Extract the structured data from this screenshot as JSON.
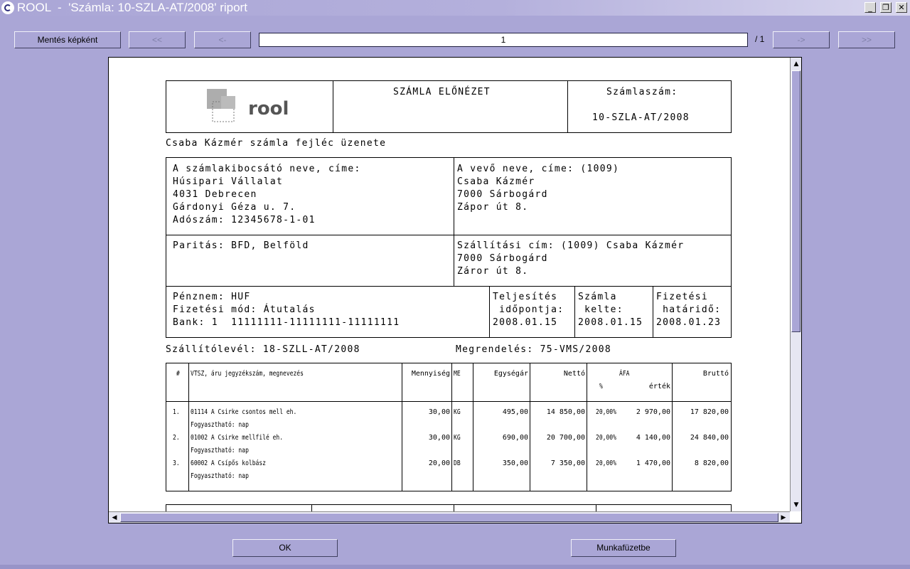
{
  "window": {
    "title": "ROOL  -  'Számla: 10-SZLA-AT/2008' riport",
    "minimize": "_",
    "restore": "❐",
    "close": "✕"
  },
  "toolbar": {
    "save_image": "Mentés képként",
    "first": "<<",
    "prev": "<-",
    "page_value": "1",
    "page_total": "/ 1",
    "next": "->",
    "last": ">>"
  },
  "invoice": {
    "logo_text": "rool",
    "title": "SZÁMLA ELŐNÉZET",
    "number_label": "Számlaszám:",
    "number": "10-SZLA-AT/2008",
    "header_message": "Csaba Kázmér számla fejléc üzenete",
    "issuer": {
      "label": "A számlakibocsátó neve, címe:",
      "name": "Húsipari Vállalat",
      "city": "4031 Debrecen",
      "street": "Gárdonyi Géza u. 7.",
      "tax": "Adószám: 12345678-1-01"
    },
    "buyer": {
      "label": "A vevő neve, címe: (1009)",
      "name": "Csaba Kázmér",
      "city": "7000 Sárbogárd",
      "street": "Zápor út 8."
    },
    "parity": "Paritás: BFD, Belföld",
    "shipping": {
      "label": "Szállítási cím: (1009) Csaba Kázmér",
      "city": "7000 Sárbogárd",
      "street": "Záror út 8."
    },
    "currency": "Pénznem: HUF",
    "payment_method": "Fizetési mód: Átutalás",
    "bank": "Bank: 1  11111111-11111111-11111111",
    "fulfil": {
      "l1": "Teljesítés",
      "l2": " időpontja:",
      "date": "2008.01.15"
    },
    "issued": {
      "l1": "Számla",
      "l2": " kelte:",
      "date": "2008.01.15"
    },
    "due": {
      "l1": "Fizetési",
      "l2": " határidő:",
      "date": "2008.01.23"
    },
    "delivery_note": "Szállítólevél: 18-SZLL-AT/2008",
    "order": "Megrendelés: 75-VMS/2008"
  },
  "items_table": {
    "headers": {
      "num": "#",
      "desc": "VTSZ, áru jegyzékszám, megnevezés",
      "qty": "Mennyiség",
      "unit": "ME",
      "unit_price": "Egységár",
      "net": "Nettó",
      "vat": "ÁFA",
      "vat_pct": "%",
      "vat_val": "érték",
      "gross": "Bruttó"
    },
    "rows": [
      {
        "num": "1.",
        "desc": "01114 A Csirke csontos mell eh.",
        "note": "Fogyasztható: nap",
        "qty": "30,00",
        "unit": "KG",
        "price": "495,00",
        "net": "14 850,00",
        "pct": "20,00%",
        "vat": "2 970,00",
        "gross": "17 820,00"
      },
      {
        "num": "2.",
        "desc": "01002 A Csirke mellfilé eh.",
        "note": "Fogyasztható: nap",
        "qty": "30,00",
        "unit": "KG",
        "price": "690,00",
        "net": "20 700,00",
        "pct": "20,00%",
        "vat": "4 140,00",
        "gross": "24 840,00"
      },
      {
        "num": "3.",
        "desc": "60002 A Csípős kolbász",
        "note": "Fogyasztható: nap",
        "qty": "20,00",
        "unit": "DB",
        "price": "350,00",
        "net": "7 350,00",
        "pct": "20,00%",
        "vat": "1 470,00",
        "gross": "8 820,00"
      }
    ]
  },
  "buttons": {
    "ok": "OK",
    "workbook": "Munkafüzetbe"
  },
  "colors": {
    "window_bg": "#aaa6d6",
    "paper": "#ffffff"
  }
}
